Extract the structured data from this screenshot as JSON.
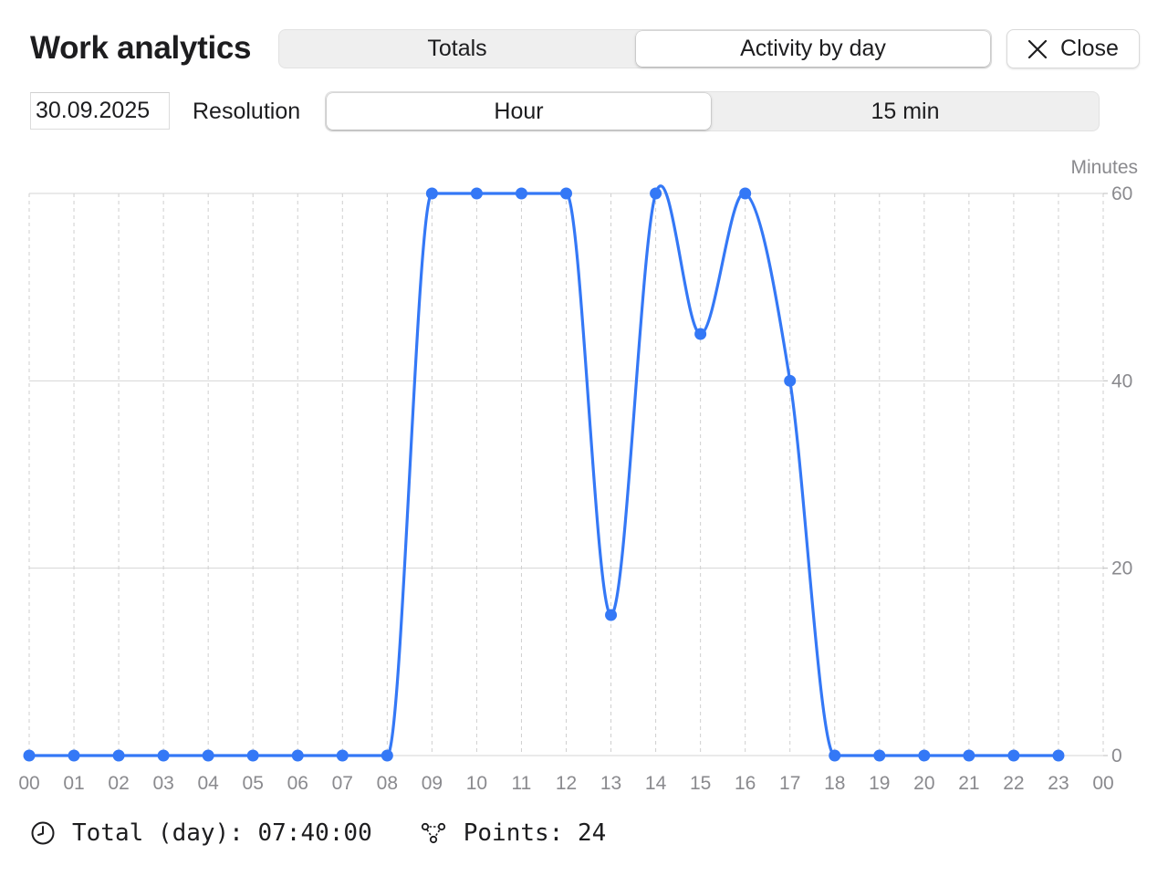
{
  "window": {
    "title": "Work analytics"
  },
  "tabs": [
    {
      "label": "Totals",
      "selected": false
    },
    {
      "label": "Activity by day",
      "selected": true
    }
  ],
  "close_button": {
    "label": "Close",
    "icon": "x-icon"
  },
  "date_field": {
    "value": "30.09.2025"
  },
  "resolution": {
    "label": "Resolution",
    "options": [
      {
        "label": "Hour",
        "selected": true
      },
      {
        "label": "15 min",
        "selected": false
      }
    ]
  },
  "chart_data": {
    "type": "line",
    "ylabel": "Minutes",
    "x": [
      "00",
      "01",
      "02",
      "03",
      "04",
      "05",
      "06",
      "07",
      "08",
      "09",
      "10",
      "11",
      "12",
      "13",
      "14",
      "15",
      "16",
      "17",
      "18",
      "19",
      "20",
      "21",
      "22",
      "23"
    ],
    "x_tick_labels": [
      "00",
      "01",
      "02",
      "03",
      "04",
      "05",
      "06",
      "07",
      "08",
      "09",
      "10",
      "11",
      "12",
      "13",
      "14",
      "15",
      "16",
      "17",
      "18",
      "19",
      "20",
      "21",
      "22",
      "23",
      "00"
    ],
    "y_ticks": [
      0,
      20,
      40,
      60
    ],
    "ylim": [
      0,
      60
    ],
    "series": [
      {
        "values": [
          0,
          0,
          0,
          0,
          0,
          0,
          0,
          0,
          0,
          60,
          60,
          60,
          60,
          15,
          60,
          45,
          60,
          40,
          0,
          0,
          0,
          0,
          0,
          0
        ]
      }
    ],
    "line_color": "#3478f6",
    "smooth": true,
    "grid": true,
    "y_axis_position": "right"
  },
  "footer": {
    "total_label": "Total (day): 07:40:00",
    "total_icon": "clock-icon",
    "points_label": "Points: 24",
    "points_icon": "nodes-icon"
  }
}
